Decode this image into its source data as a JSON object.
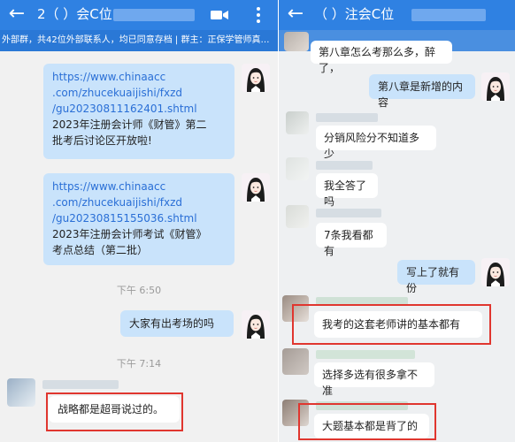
{
  "left": {
    "header": {
      "back_icon": "←",
      "title_visible": "2（      ）会C位",
      "subtitle": "外部群，共42位外部联系人，均已同意存档 | 群主：正保学管师真…",
      "icons": [
        "video-call-icon",
        "more-vertical-icon"
      ]
    },
    "messages": [
      {
        "side": "out",
        "link": "https://www.chinaacc.com/zhucekuaijishi/fxzd/gu20230811162401.shtml",
        "link_lines": [
          "https://www.chinaacc",
          ".com/zhucekuaijishi/fxzd",
          "/gu20230811162401.shtml"
        ],
        "text_lines": [
          "2023年注册会计师《财管》第二",
          "批考后讨论区开放啦!"
        ]
      },
      {
        "side": "out",
        "link": "https://www.chinaacc.com/zhucekuaijishi/fxzd/gu20230815155036.shtml",
        "link_lines": [
          "https://www.chinaacc",
          ".com/zhucekuaijishi/fxzd",
          "/gu20230815155036.shtml"
        ],
        "text_lines": [
          "2023年注册会计师考试《财管》",
          "考点总结（第二批）"
        ]
      },
      {
        "side": "time",
        "text": "下午 6:50"
      },
      {
        "side": "out",
        "text": "大家有出考场的吗"
      },
      {
        "side": "time",
        "text": "下午 7:14"
      },
      {
        "side": "in",
        "text": "战略都是超哥说过的。"
      }
    ]
  },
  "right": {
    "header": {
      "back_icon": "←",
      "title_visible": "（      ）注会C位"
    },
    "messages": [
      {
        "side": "in",
        "text": "第八章怎么考那么多，醉了，"
      },
      {
        "side": "out",
        "text": "第八章是新增的内容"
      },
      {
        "side": "in",
        "text": "分销风险分不知道多少"
      },
      {
        "side": "in",
        "text": "我全答了吗"
      },
      {
        "side": "in",
        "text": "7条我看都有"
      },
      {
        "side": "out",
        "text": "写上了就有份"
      },
      {
        "side": "in",
        "text": "我考的这套老师讲的基本都有"
      },
      {
        "side": "in",
        "text": "选择多选有很多拿不准"
      },
      {
        "side": "in",
        "text": "大题基本都是背了的"
      }
    ]
  },
  "colors": {
    "header": "#2f81e2",
    "outgoing_bubble": "#c9e3fb",
    "incoming_bubble": "#ffffff",
    "highlight": "#e0362f",
    "link": "#2a6fd6"
  }
}
